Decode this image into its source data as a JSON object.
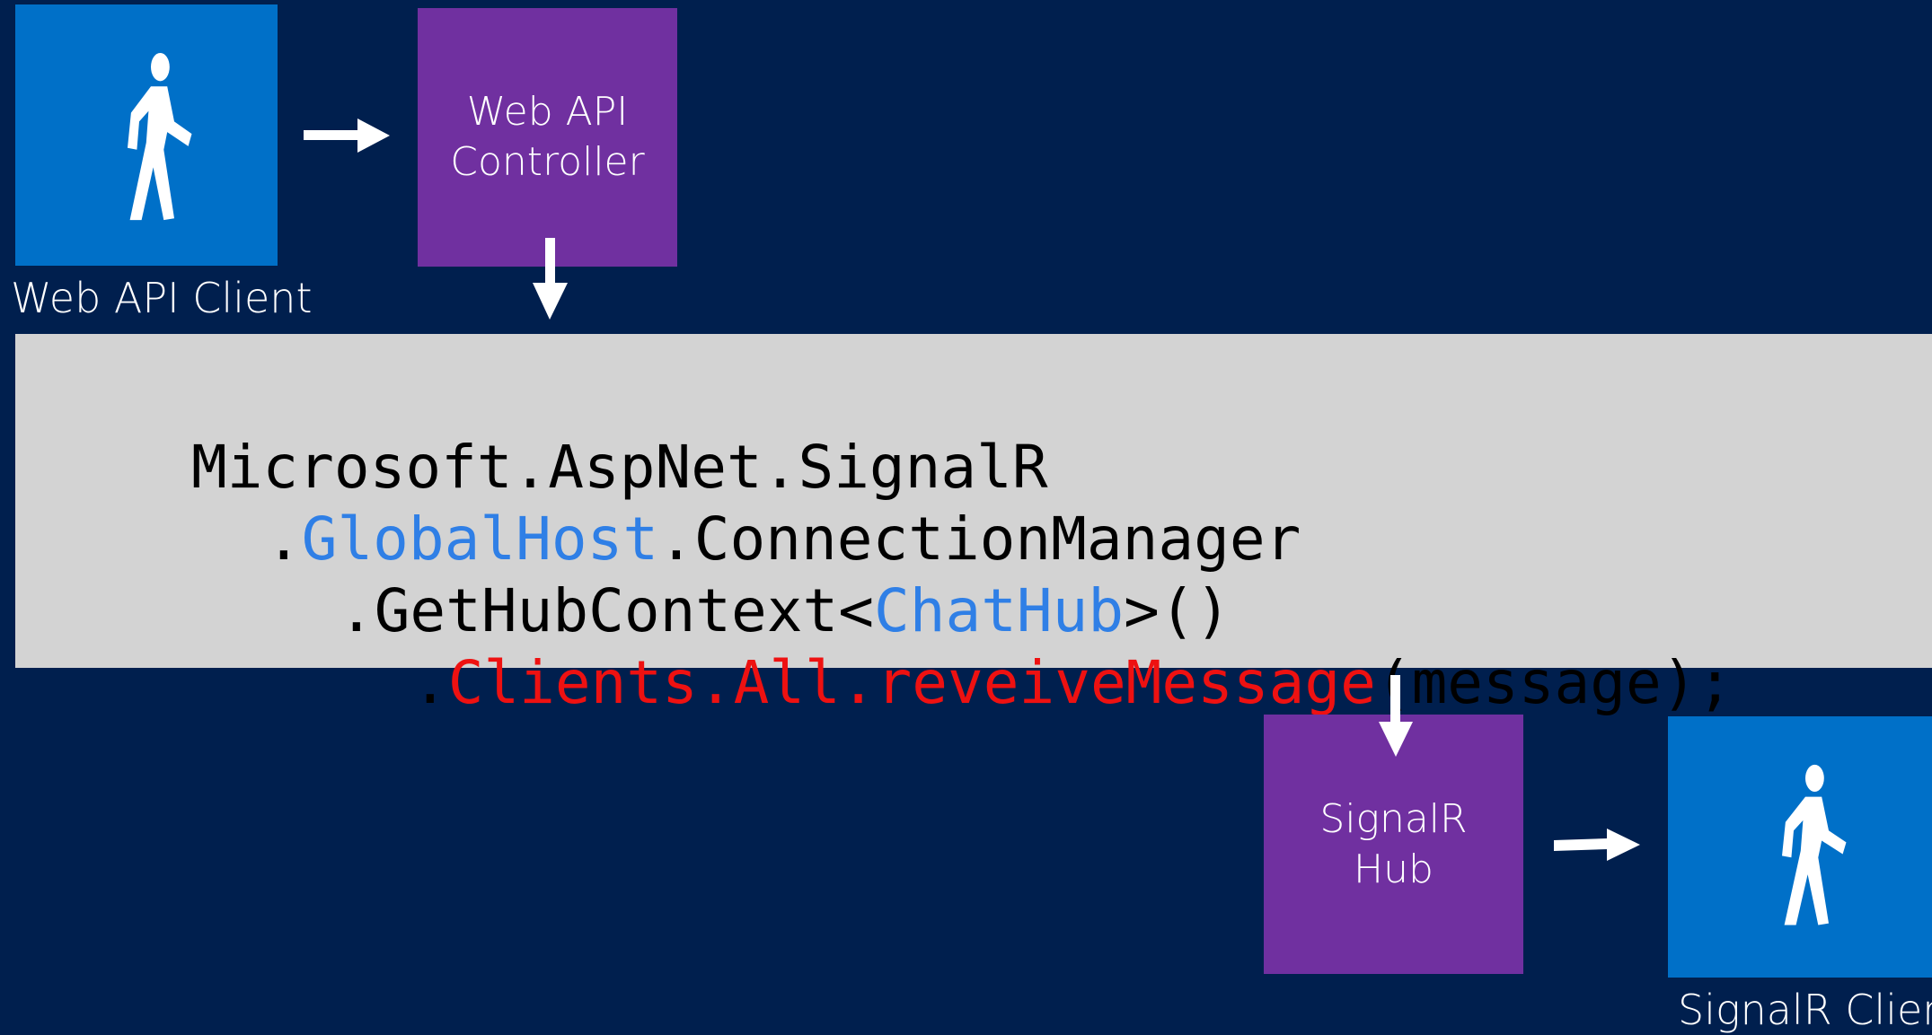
{
  "diagram": {
    "nodes": {
      "web_api_client": {
        "caption": "Web API Client"
      },
      "web_api_controller": {
        "label": "Web API\nController"
      },
      "signalr_hub": {
        "label": "SignalR\nHub"
      },
      "signalr_client": {
        "caption": "SignalR Client"
      }
    },
    "code": {
      "line1": {
        "text": "Microsoft.AspNet.SignalR"
      },
      "line2": {
        "dot": ".",
        "global_host": "GlobalHost",
        "rest": ".ConnectionManager"
      },
      "line3": {
        "prefix": ".GetHubContext<",
        "chat_hub": "ChatHub",
        "suffix": ">()"
      },
      "line4": {
        "dot": ".",
        "call": "Clients.All.reveiveMessage",
        "args": "(message);"
      }
    }
  },
  "colors": {
    "background": "#001f4e",
    "client_tile": "#0070c8",
    "server_tile": "#7030a0",
    "code_background": "#d3d3d3",
    "code_type_highlight": "#2f7fe6",
    "code_call_highlight": "#ee1111",
    "arrow": "#ffffff"
  },
  "icons": {
    "client": "walking-person-icon",
    "flow": "arrow-icon"
  }
}
